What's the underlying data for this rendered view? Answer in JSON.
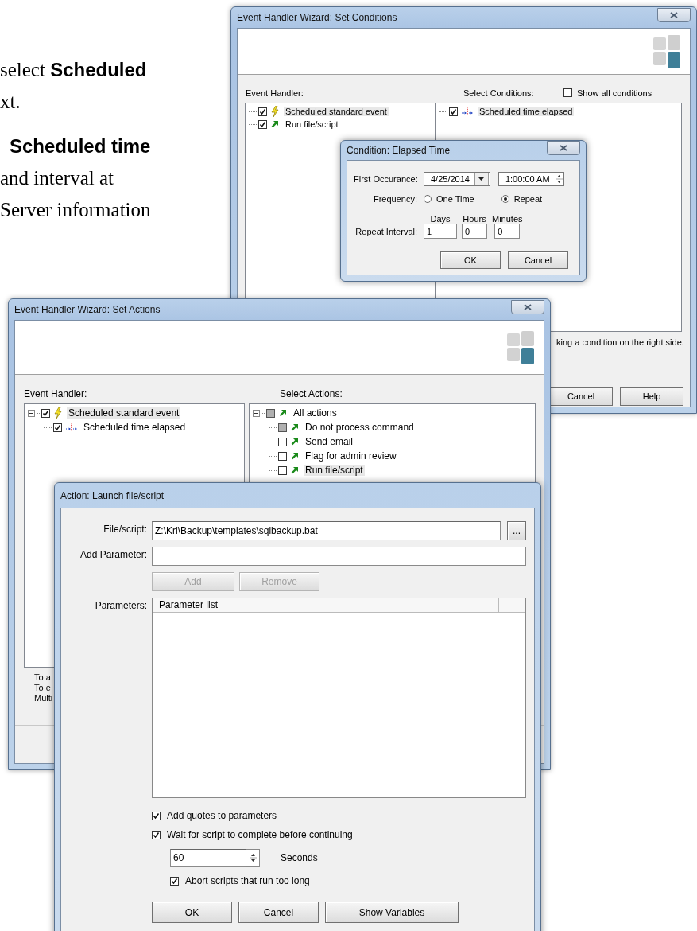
{
  "document_text": [
    {
      "lines": [
        {
          "text": "select **Scheduled**",
          "bold": false
        },
        {
          "text": "xt.",
          "bold": false
        }
      ]
    },
    {
      "lines": [
        {
          "text": "Scheduled time",
          "bold": true
        },
        {
          "text": "and interval at",
          "bold": false
        },
        {
          "text": "Server information",
          "bold": false
        }
      ]
    }
  ],
  "conditions_window": {
    "title": "Event Handler Wizard: Set Conditions",
    "event_handler_label": "Event Handler:",
    "event_handler_tree": [
      {
        "label": "Scheduled standard event",
        "kind": "event",
        "checked": true,
        "selected": true
      },
      {
        "label": "Run file/script",
        "kind": "action",
        "checked": true,
        "selected": false
      }
    ],
    "select_conditions_label": "Select Conditions:",
    "show_all_conditions": {
      "label": "Show all conditions",
      "checked": false
    },
    "conditions_tree": [
      {
        "label": "Scheduled time elapsed",
        "kind": "condition",
        "checked": true,
        "selected": true
      }
    ],
    "hint": "king a condition on the right side.",
    "buttons": [
      "Cancel",
      "Help"
    ]
  },
  "elapsed_time_dialog": {
    "title": "Condition: Elapsed Time",
    "first_occurance": {
      "label": "First Occurance:",
      "date": "4/25/2014",
      "time": "1:00:00 AM"
    },
    "frequency": {
      "label": "Frequency:",
      "options": [
        {
          "label": "One Time",
          "selected": false
        },
        {
          "label": "Repeat",
          "selected": true
        }
      ]
    },
    "repeat_interval": {
      "label": "Repeat Interval:",
      "fields": [
        {
          "label": "Days",
          "value": "1"
        },
        {
          "label": "Hours",
          "value": "0"
        },
        {
          "label": "Minutes",
          "value": "0"
        }
      ]
    },
    "buttons": [
      "OK",
      "Cancel"
    ]
  },
  "actions_window": {
    "title": "Event Handler Wizard: Set Actions",
    "event_handler_label": "Event Handler:",
    "event_handler_tree": [
      {
        "label": "Scheduled standard event",
        "kind": "event",
        "checked": true,
        "mixed": false,
        "selected": true,
        "expanded": true,
        "children": [
          {
            "label": "Scheduled time elapsed",
            "kind": "condition",
            "checked": true,
            "mixed": false,
            "selected": false
          }
        ]
      }
    ],
    "select_actions_label": "Select Actions:",
    "actions_tree": [
      {
        "label": "All actions",
        "kind": "action",
        "checked": false,
        "mixed": true,
        "selected": false,
        "expanded": true,
        "children": [
          {
            "label": "Do not process command",
            "kind": "action",
            "checked": false,
            "mixed": true,
            "selected": false
          },
          {
            "label": "Send email",
            "kind": "action",
            "checked": false,
            "mixed": false,
            "selected": false
          },
          {
            "label": "Flag for admin review",
            "kind": "action",
            "checked": false,
            "mixed": false,
            "selected": false
          },
          {
            "label": "Run file/script",
            "kind": "action",
            "checked": false,
            "mixed": false,
            "selected": true
          }
        ]
      }
    ],
    "hint_lines": [
      "To a",
      "To e",
      "Multi"
    ]
  },
  "launch_dialog": {
    "title": "Action: Launch file/script",
    "file_script": {
      "label": "File/script:",
      "value": "Z:\\Kri\\Backup\\templates\\sqlbackup.bat",
      "browse": "..."
    },
    "add_parameter": {
      "label": "Add Parameter:"
    },
    "param_buttons": [
      {
        "label": "Add",
        "disabled": true
      },
      {
        "label": "Remove",
        "disabled": true
      }
    ],
    "parameters": {
      "label": "Parameters:",
      "columns": [
        "Parameter list"
      ]
    },
    "options": [
      {
        "label": "Add quotes to parameters",
        "checked": true
      },
      {
        "label": "Wait for script to complete before continuing",
        "checked": true
      }
    ],
    "timeout": {
      "value": "60",
      "unit": "Seconds"
    },
    "abort": {
      "label": "Abort scripts that run too long",
      "checked": true
    },
    "buttons": [
      "OK",
      "Cancel",
      "Show Variables"
    ]
  }
}
